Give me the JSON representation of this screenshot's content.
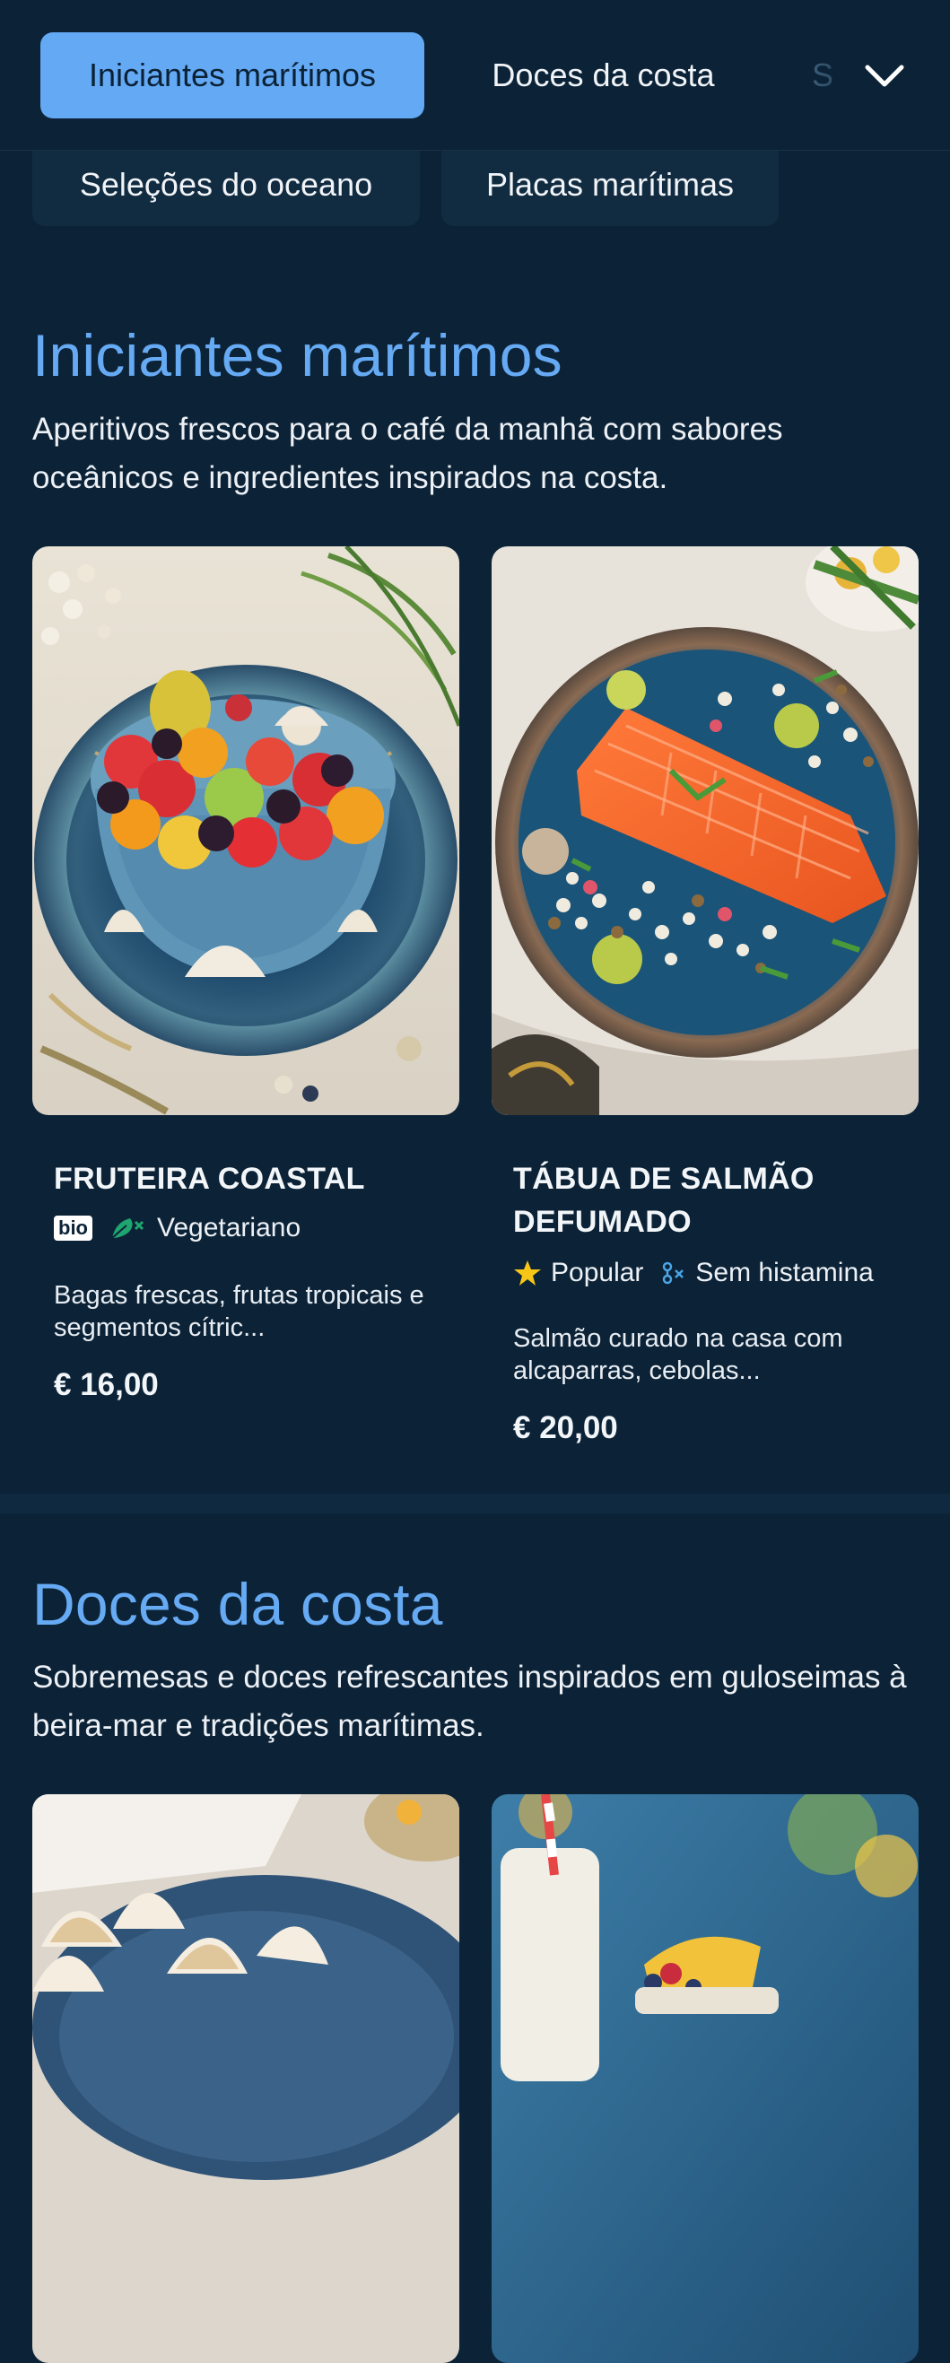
{
  "tabs": {
    "row1": [
      "Iniciantes marítimos",
      "Doces da costa",
      "S"
    ],
    "row2": [
      "Seleções do oceano",
      "Placas marítimas"
    ]
  },
  "sections": [
    {
      "title": "Iniciantes marítimos",
      "description": "Aperitivos frescos para o café da manhã com sabores oceânicos e ingredientes inspirados na costa.",
      "items": [
        {
          "name": "FRUTEIRA COASTAL",
          "badge": "bio",
          "tags": [
            "Vegetariano"
          ],
          "tag_icons": [
            "bio-badge",
            "vegetarian-leaf-icon"
          ],
          "description": "Bagas frescas, frutas tropicais e segmentos cítric...",
          "price": "€ 16,00"
        },
        {
          "name": "TÁBUA DE SALMÃO DEFUMADO",
          "tags": [
            "Popular",
            "Sem histamina"
          ],
          "tag_icons": [
            "star-icon",
            "no-histamine-icon"
          ],
          "description": "Salmão curado na casa com alcaparras, cebolas...",
          "price": "€ 20,00"
        }
      ]
    },
    {
      "title": "Doces da costa",
      "description": "Sobremesas e doces refrescantes inspirados em guloseimas à beira-mar e tradições marítimas."
    }
  ],
  "icons": {
    "expand": "chevron-down-icon"
  },
  "colors": {
    "background": "#0c2337",
    "accent": "#64a9f4",
    "chip": "#112b40",
    "star": "#f5c518",
    "veg": "#1fa56f",
    "histamine": "#4aa6e8"
  }
}
